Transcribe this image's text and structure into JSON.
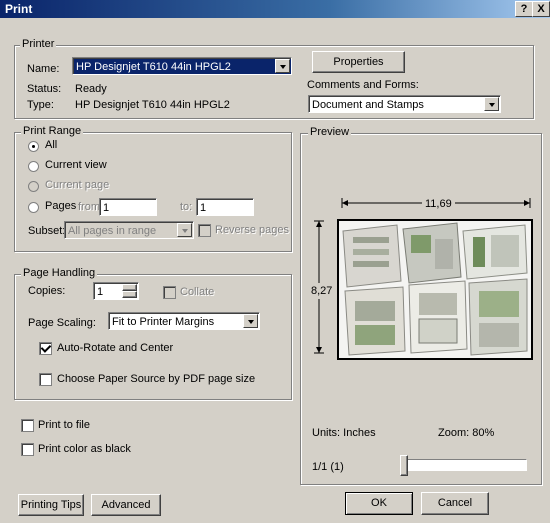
{
  "window": {
    "title": "Print",
    "help_label": "?",
    "close_label": "X"
  },
  "printer": {
    "group_label": "Printer",
    "name_label": "Name:",
    "name_value": "HP Designjet T610 44in HPGL2",
    "status_label": "Status:",
    "status_value": "Ready",
    "type_label": "Type:",
    "type_value": "HP Designjet T610 44in HPGL2",
    "properties_label": "Properties",
    "comments_label": "Comments and Forms:",
    "comments_value": "Document and Stamps"
  },
  "print_range": {
    "group_label": "Print Range",
    "all_label": "All",
    "current_view_label": "Current view",
    "current_page_label": "Current page",
    "pages_label": "Pages",
    "from_label": "from:",
    "from_value": "1",
    "to_label": "to:",
    "to_value": "1",
    "subset_label": "Subset:",
    "subset_value": "All pages in range",
    "reverse_label": "Reverse pages"
  },
  "page_handling": {
    "group_label": "Page Handling",
    "copies_label": "Copies:",
    "copies_value": "1",
    "collate_label": "Collate",
    "scaling_label": "Page Scaling:",
    "scaling_value": "Fit to Printer Margins",
    "autorotate_label": "Auto-Rotate and Center",
    "paper_source_label": "Choose Paper Source by PDF page size"
  },
  "options": {
    "print_to_file_label": "Print to file",
    "print_black_label": "Print color as black"
  },
  "preview": {
    "group_label": "Preview",
    "width_value": "11,69",
    "height_value": "8,27",
    "units_label": "Units: Inches",
    "zoom_label": "Zoom:  80%",
    "page_counter": "1/1 (1)"
  },
  "footer": {
    "tips_label": "Printing Tips",
    "advanced_label": "Advanced",
    "ok_label": "OK",
    "cancel_label": "Cancel"
  }
}
